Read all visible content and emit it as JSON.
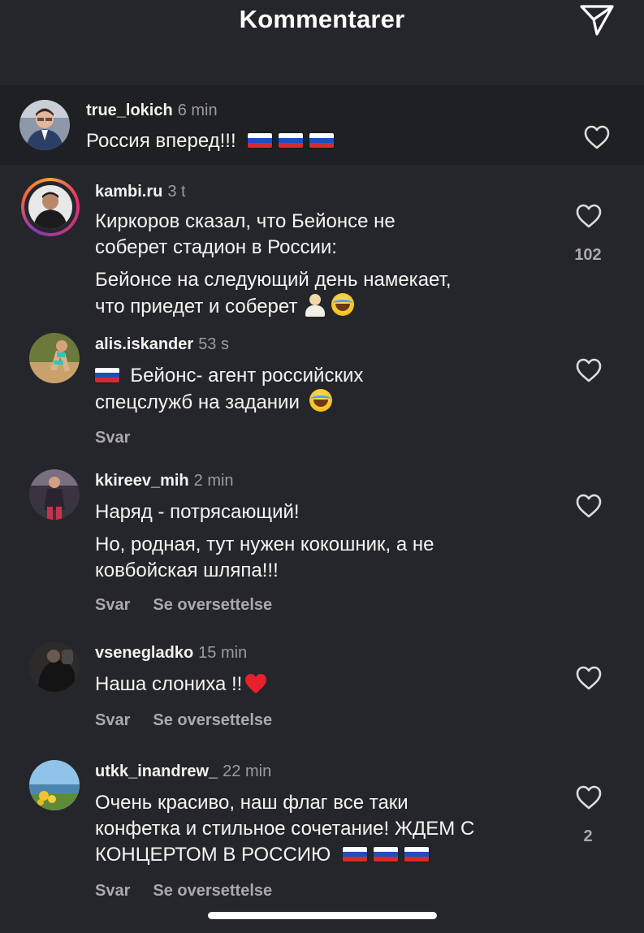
{
  "header": {
    "title": "Kommentarer",
    "send_icon": "send-paper-plane-icon"
  },
  "comments": [
    {
      "username": "true_lokich",
      "time": "6 min",
      "lines": [
        "Россия вперед!!!"
      ],
      "flags": 3,
      "likes": "",
      "actions": [],
      "highlight": true
    },
    {
      "username": "kambi.ru",
      "time": "3 t",
      "lines": [
        "Киркоров сказал, что Бейонсе не",
        "соберет стадион в России:",
        "Бейонсе на следующий день намекает,",
        "что приедет и соберет"
      ],
      "likes": "102",
      "actions": [],
      "story_ring": true
    },
    {
      "username": "alis.iskander",
      "time": "53 s",
      "lines": [
        "Бейонс- агент российских",
        "спецслужб на задании"
      ],
      "likes": "",
      "actions": [
        "Svar"
      ]
    },
    {
      "username": "kkireev_mih",
      "time": "2 min",
      "lines": [
        "Наряд - потрясающий!",
        "Но, родная, тут нужен кокошник, а не",
        "ковбойская шляпа!!!"
      ],
      "likes": "",
      "actions": [
        "Svar",
        "Se oversettelse"
      ]
    },
    {
      "username": "vsenegladko",
      "time": "15 min",
      "lines": [
        "Наша слониха !!"
      ],
      "likes": "",
      "actions": [
        "Svar",
        "Se oversettelse"
      ]
    },
    {
      "username": "utkk_inandrew_",
      "time": "22 min",
      "lines": [
        "Очень красиво, наш флаг все таки",
        "конфетка и стильное сочетание! ЖДЕМ С",
        "КОНЦЕРТОМ В РОССИЮ"
      ],
      "flags": 3,
      "likes": "2",
      "actions": [
        "Svar",
        "Se oversettelse"
      ]
    }
  ],
  "colors": {
    "background": "#25262b",
    "text": "#f4f4f4",
    "secondary": "#9b9ba0"
  }
}
